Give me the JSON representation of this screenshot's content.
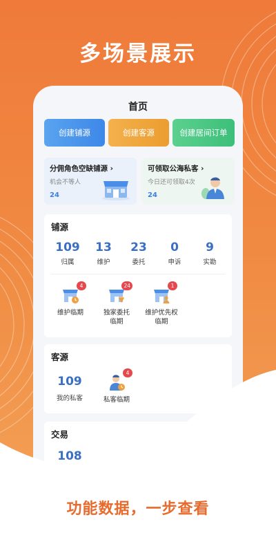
{
  "headline": "多场景展示",
  "footer_title": "功能数据，一步查看",
  "nav": {
    "title": "首页"
  },
  "quick_actions": [
    {
      "label": "创建铺源",
      "color": "#4a95ec"
    },
    {
      "label": "创建客源",
      "color": "#f0a83e"
    },
    {
      "label": "创建居间订单",
      "color": "#4cc886"
    }
  ],
  "promos": [
    {
      "title": "分佣角色空缺铺源",
      "subtitle": "机会不等人",
      "count": "24",
      "icon": "shop-icon"
    },
    {
      "title": "可领取公海私客",
      "subtitle": "今日还可领取4次",
      "count": "24",
      "icon": "person-icon"
    }
  ],
  "shop_source": {
    "title": "铺源",
    "stats": [
      {
        "value": "109",
        "label": "归属"
      },
      {
        "value": "13",
        "label": "维护"
      },
      {
        "value": "23",
        "label": "委托"
      },
      {
        "value": "0",
        "label": "申诉"
      },
      {
        "value": "9",
        "label": "实勘"
      }
    ],
    "reminders": [
      {
        "line1": "维护临期",
        "line2": "",
        "badge": "4",
        "icon": "shop-clock-icon"
      },
      {
        "line1": "独家委托",
        "line2": "临期",
        "badge": "24",
        "icon": "shop-diamond-icon"
      },
      {
        "line1": "维护优先权",
        "line2": "临期",
        "badge": "1",
        "icon": "shop-person-icon"
      }
    ]
  },
  "customer_source": {
    "title": "客源",
    "stat": {
      "value": "109",
      "label": "我的私客"
    },
    "reminder": {
      "label": "私客临期",
      "badge": "4",
      "icon": "person-clock-icon"
    }
  },
  "trade": {
    "title": "交易",
    "partial_value": "108"
  },
  "colors": {
    "accent": "#ef7a3a",
    "stat_blue": "#3a6fc4",
    "badge_red": "#e5484d"
  }
}
